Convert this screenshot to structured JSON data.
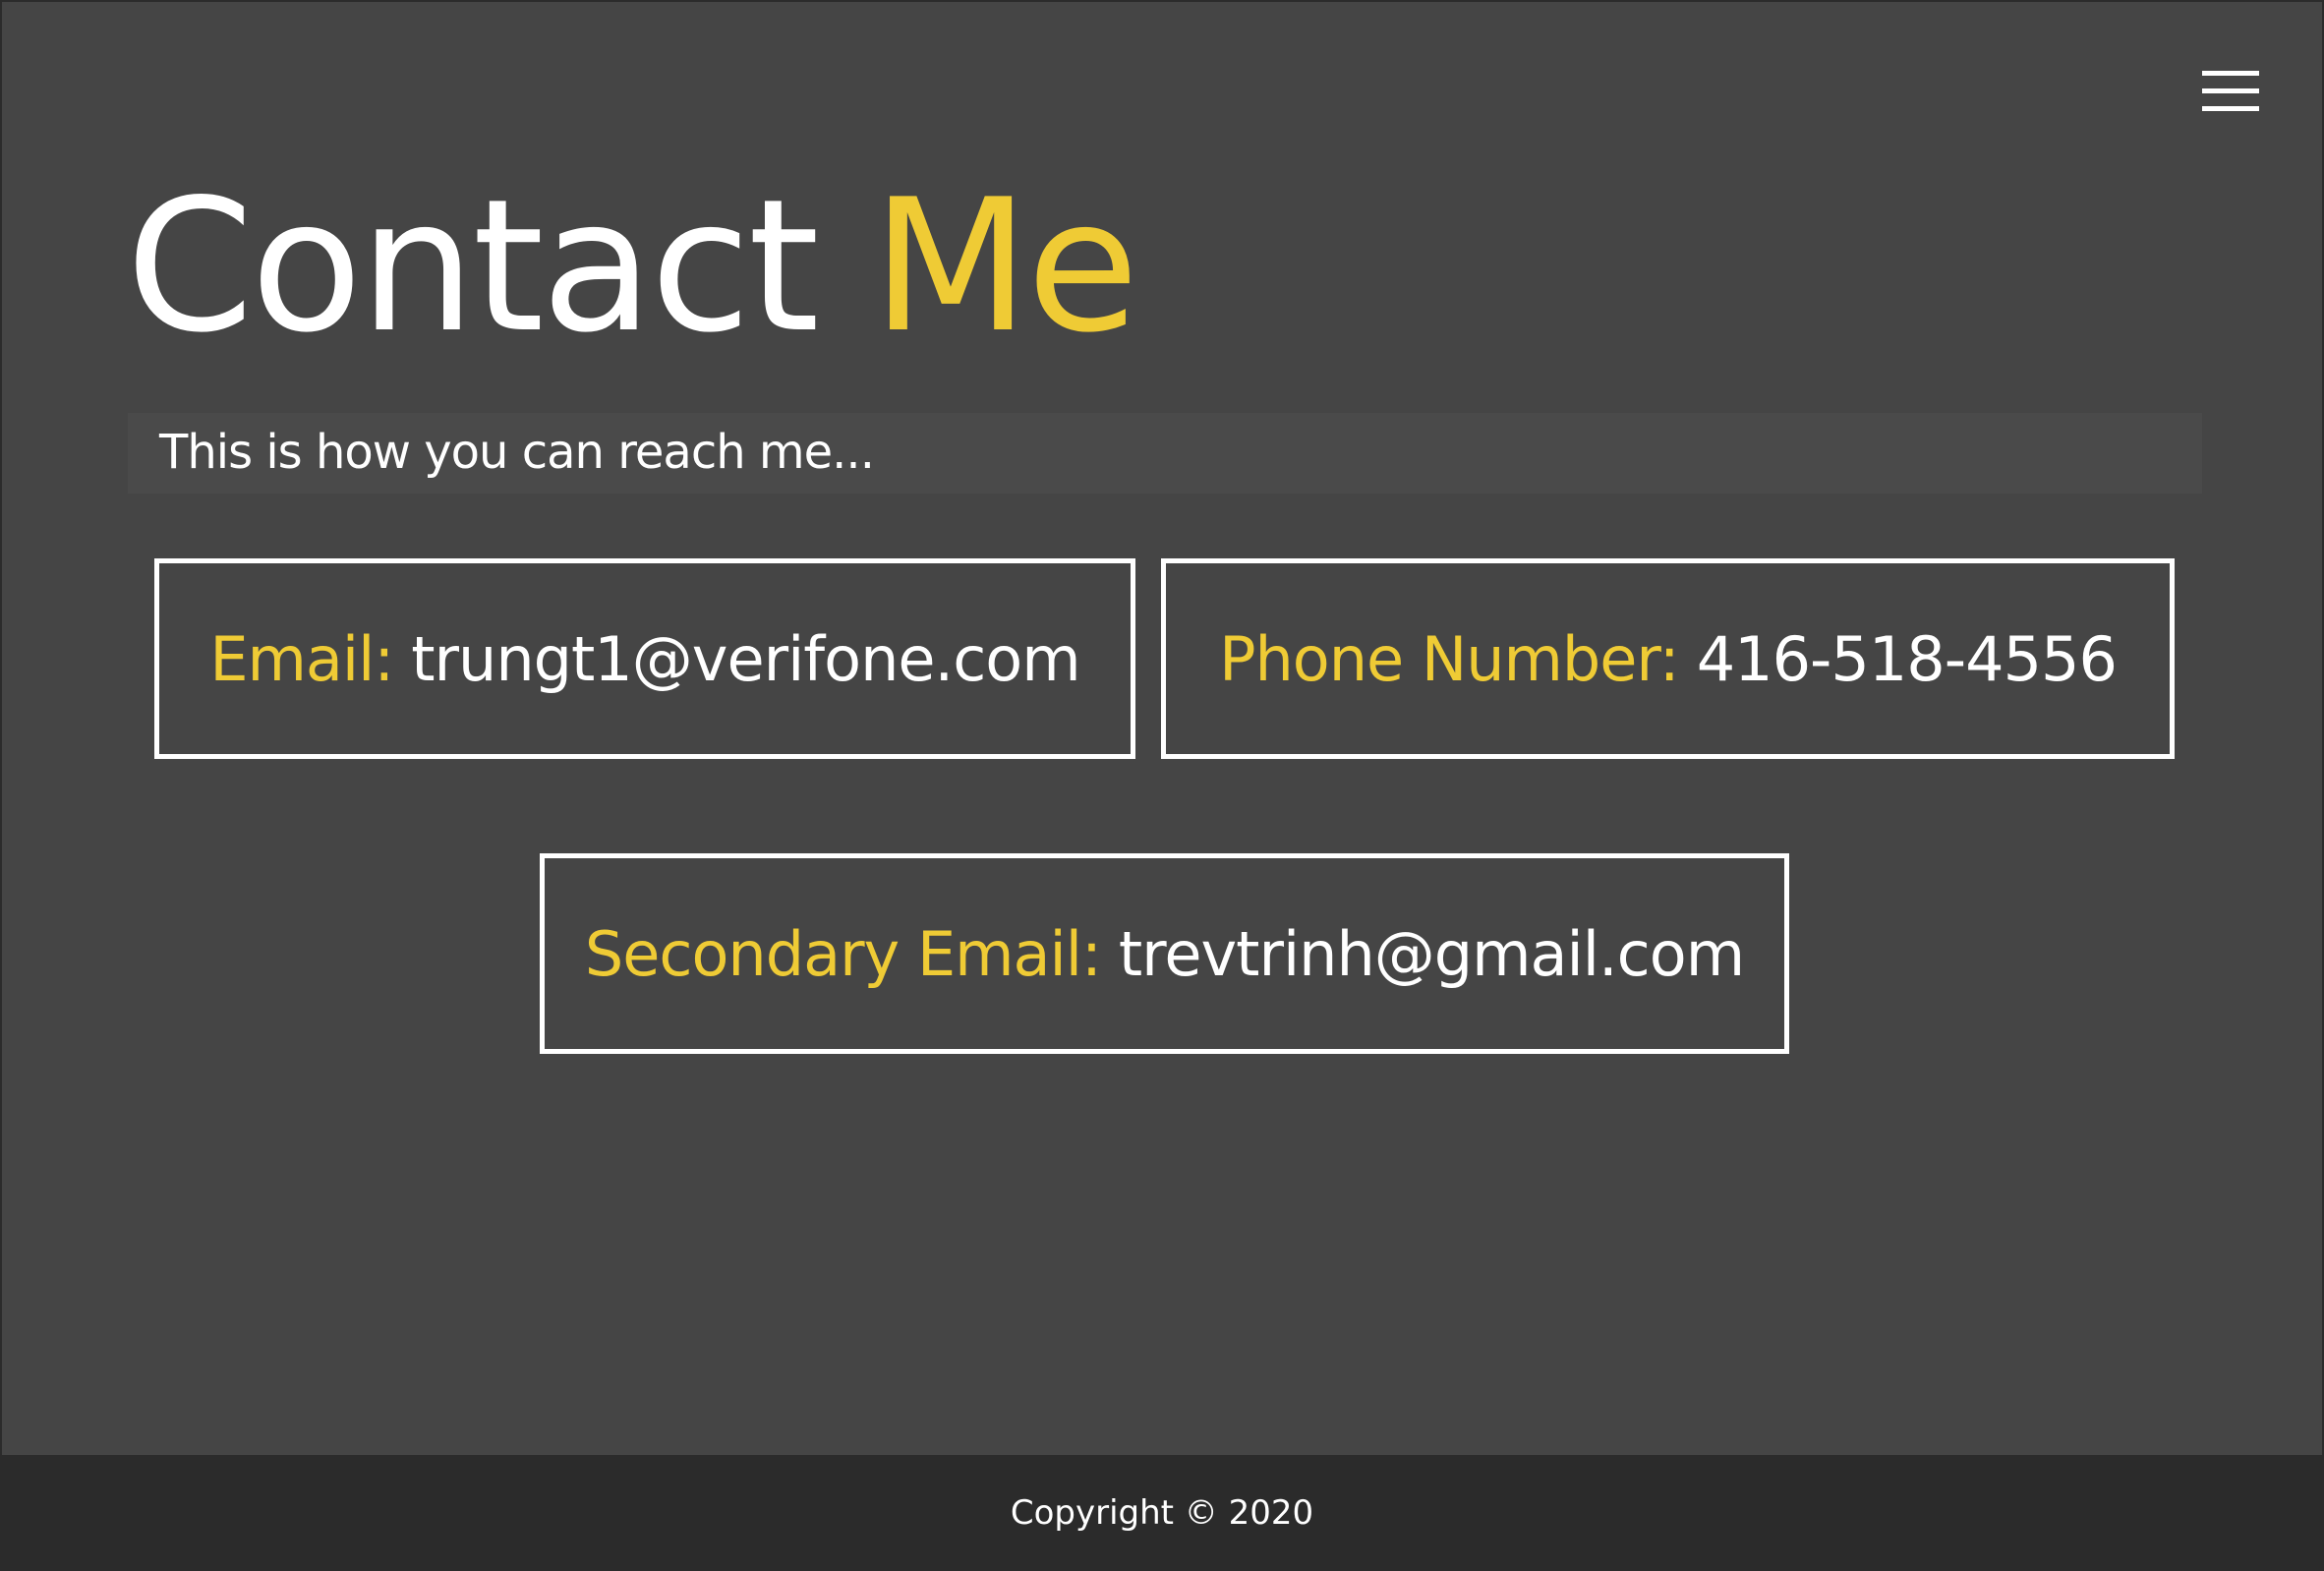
{
  "header": {
    "menu_icon": "hamburger-menu-icon",
    "title_main": "Contact ",
    "title_accent": "Me"
  },
  "intro": {
    "text": "This is how you can reach me..."
  },
  "contacts": [
    {
      "label": "Email:",
      "value": "trungt1@verifone.com"
    },
    {
      "label": "Phone Number:",
      "value": "416-518-4556"
    },
    {
      "label": "Secondary Email:",
      "value": "trevtrinh@gmail.com"
    }
  ],
  "footer": {
    "copyright": "Copyright © 2020"
  },
  "colors": {
    "background": "#454545",
    "accent": "#efcb35",
    "text": "#ffffff",
    "footer": "#2b2b2b",
    "card_border": "#ffffff"
  }
}
